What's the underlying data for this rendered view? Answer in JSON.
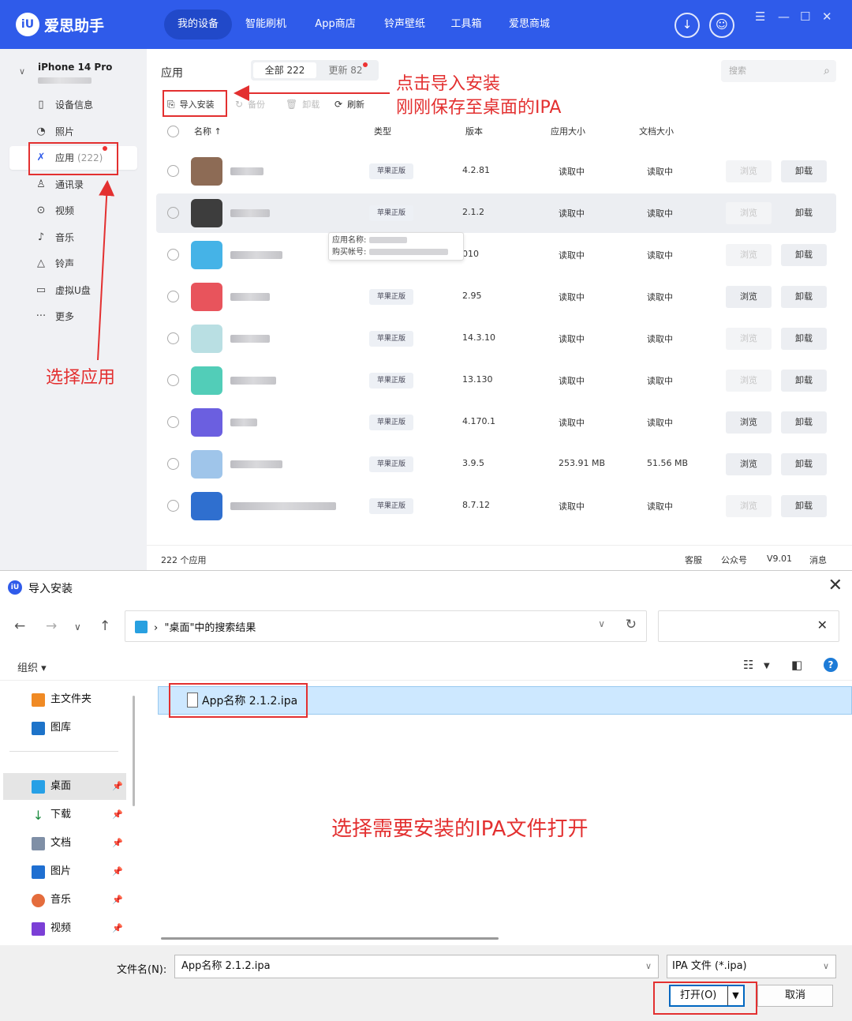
{
  "app": {
    "logo_text": "iU",
    "title": "爱思助手",
    "nav": [
      "我的设备",
      "智能刷机",
      "App商店",
      "铃声壁纸",
      "工具箱",
      "爱思商城"
    ],
    "device_name": "iPhone 14 Pro",
    "sidebar": [
      {
        "label": "设备信息",
        "icon": "phone-icon"
      },
      {
        "label": "照片",
        "icon": "photo-icon"
      },
      {
        "label": "应用",
        "icon": "app-store-icon",
        "count": "(222)"
      },
      {
        "label": "通讯录",
        "icon": "contacts-icon"
      },
      {
        "label": "视频",
        "icon": "video-icon"
      },
      {
        "label": "音乐",
        "icon": "music-icon"
      },
      {
        "label": "铃声",
        "icon": "bell-icon"
      },
      {
        "label": "虚拟U盘",
        "icon": "usb-icon"
      },
      {
        "label": "更多",
        "icon": "more-icon"
      }
    ],
    "section_title": "应用",
    "tabs": {
      "all": "全部 222",
      "update": "更新 82"
    },
    "search_placeholder": "搜索",
    "toolbar": {
      "import": "导入安装",
      "backup": "备份",
      "uninstall": "卸载",
      "refresh": "刷新"
    },
    "columns": {
      "name": "名称 ↑",
      "type": "类型",
      "version": "版本",
      "app_size": "应用大小",
      "doc_size": "文档大小"
    },
    "rows": [
      {
        "tag": "苹果正版",
        "version": "4.2.81",
        "app_size": "读取中",
        "doc_size": "读取中",
        "browse": "浏览",
        "browse_enabled": false,
        "uninstall": "卸载",
        "icon_color": "#8d6b55"
      },
      {
        "tag": "苹果正版",
        "version": "2.1.2",
        "app_size": "读取中",
        "doc_size": "读取中",
        "browse": "浏览",
        "browse_enabled": false,
        "uninstall": "卸载",
        "icon_color": "#3d3d3d"
      },
      {
        "tag": "",
        "version": "010",
        "app_size": "读取中",
        "doc_size": "读取中",
        "browse": "浏览",
        "browse_enabled": false,
        "uninstall": "卸载",
        "icon_color": "#45b3e7"
      },
      {
        "tag": "苹果正版",
        "version": "2.95",
        "app_size": "读取中",
        "doc_size": "读取中",
        "browse": "浏览",
        "browse_enabled": true,
        "uninstall": "卸载",
        "icon_color": "#e8545c"
      },
      {
        "tag": "苹果正版",
        "version": "14.3.10",
        "app_size": "读取中",
        "doc_size": "读取中",
        "browse": "浏览",
        "browse_enabled": false,
        "uninstall": "卸载",
        "icon_color": "#b9dfe3"
      },
      {
        "tag": "苹果正版",
        "version": "13.130",
        "app_size": "读取中",
        "doc_size": "读取中",
        "browse": "浏览",
        "browse_enabled": false,
        "uninstall": "卸载",
        "icon_color": "#52cdb8"
      },
      {
        "tag": "苹果正版",
        "version": "4.170.1",
        "app_size": "读取中",
        "doc_size": "读取中",
        "browse": "浏览",
        "browse_enabled": true,
        "uninstall": "卸载",
        "icon_color": "#6b5fe0"
      },
      {
        "tag": "苹果正版",
        "version": "3.9.5",
        "app_size": "253.91 MB",
        "doc_size": "51.56 MB",
        "browse": "浏览",
        "browse_enabled": true,
        "uninstall": "卸载",
        "icon_color": "#9fc5ea"
      },
      {
        "tag": "苹果正版",
        "version": "8.7.12",
        "app_size": "读取中",
        "doc_size": "读取中",
        "browse": "浏览",
        "browse_enabled": false,
        "uninstall": "卸载",
        "icon_color": "#2f6fcf"
      }
    ],
    "tooltip": {
      "name_label": "应用名称:",
      "account_label": "购买帐号:"
    },
    "status": {
      "count": "222 个应用",
      "service": "客服",
      "wechat": "公众号",
      "version": "V9.01",
      "msg": "消息"
    },
    "colors": {
      "brand": "#2f5bea",
      "annotation": "#e33030"
    }
  },
  "annotations": {
    "click_import": "点击导入安装",
    "saved_ipa": "刚刚保存至桌面的IPA",
    "select_app": "选择应用",
    "select_ipa": "选择需要安装的IPA文件打开"
  },
  "dialog": {
    "title": "导入安装",
    "path": "\"桌面\"中的搜索结果",
    "organize": "组织 ▾",
    "nav": [
      {
        "label": "主文件夹",
        "icon": "home-icon"
      },
      {
        "label": "图库",
        "icon": "gallery-icon"
      },
      {
        "label": "桌面",
        "icon": "desktop-icon"
      },
      {
        "label": "下载",
        "icon": "download-icon"
      },
      {
        "label": "文档",
        "icon": "documents-icon"
      },
      {
        "label": "图片",
        "icon": "pictures-icon"
      },
      {
        "label": "音乐",
        "icon": "music-icon"
      },
      {
        "label": "视频",
        "icon": "videos-icon"
      }
    ],
    "file": "App名称  2.1.2.ipa",
    "filename_label": "文件名(N):",
    "filename_value": "App名称 2.1.2.ipa",
    "filetype": "IPA 文件 (*.ipa)",
    "open": "打开(O)",
    "cancel": "取消"
  }
}
